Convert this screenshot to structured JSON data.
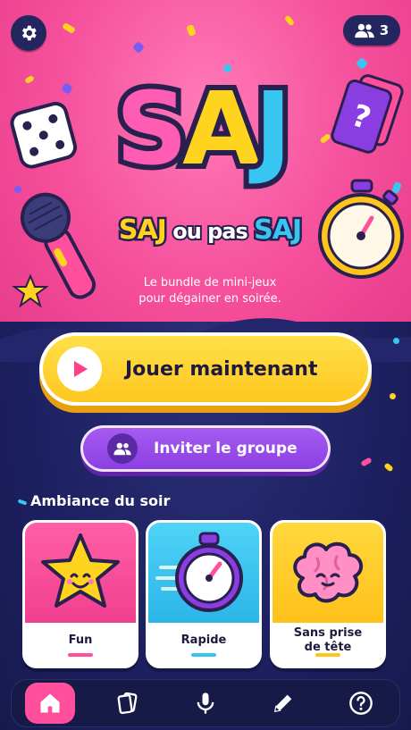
{
  "header": {
    "settings_icon": "gear-icon",
    "players_icon": "group-icon",
    "players_count": "3"
  },
  "logo": {
    "letters": [
      "S",
      "A",
      "J"
    ],
    "subtitle_part1": "SAJ",
    "subtitle_part2": " ou pas ",
    "subtitle_part3": "SAJ"
  },
  "tagline": {
    "line1": "Le bundle de mini-jeux",
    "line2": "pour dégainer en soirée."
  },
  "actions": {
    "play_label": "Jouer maintenant",
    "invite_label": "Inviter le groupe"
  },
  "ambiance": {
    "title": "Ambiance du soir",
    "cards": [
      {
        "label": "Fun",
        "icon": "star-icon",
        "color": "#ff4f9d"
      },
      {
        "label": "Rapide",
        "icon": "stopwatch-icon",
        "color": "#37c6f2"
      },
      {
        "label_line1": "Sans prise",
        "label_line2": "de tête",
        "icon": "brain-icon",
        "color": "#ffc51d"
      }
    ]
  },
  "nav": {
    "items": [
      {
        "icon": "home-icon",
        "active": true
      },
      {
        "icon": "cards-icon",
        "active": false
      },
      {
        "icon": "microphone-icon",
        "active": false
      },
      {
        "icon": "pencil-icon",
        "active": false
      },
      {
        "icon": "help-icon",
        "active": false
      }
    ]
  },
  "colors": {
    "pink": "#f54e9a",
    "navy": "#1c1f55",
    "yellow": "#ffd41f",
    "cyan": "#37c6f2",
    "purple": "#8a3ee2"
  }
}
